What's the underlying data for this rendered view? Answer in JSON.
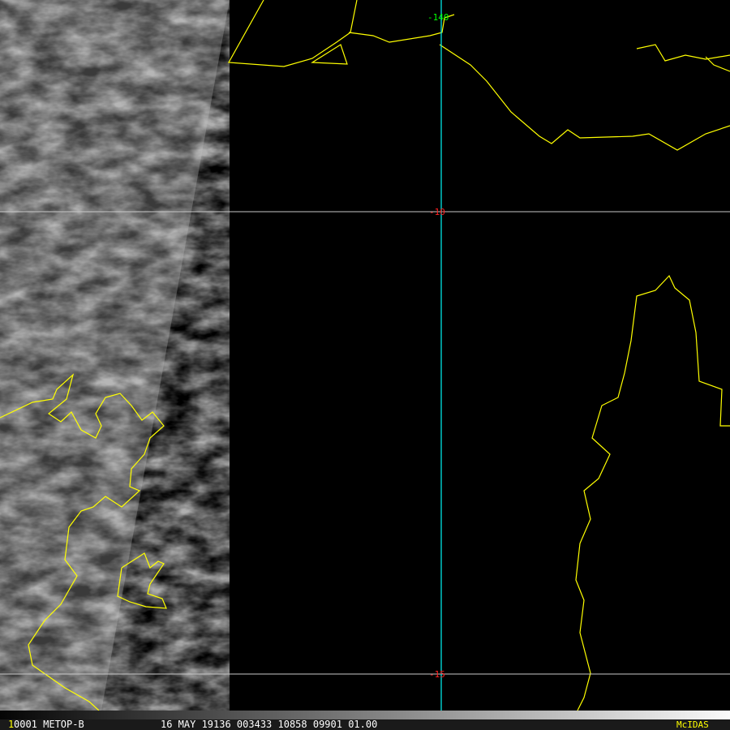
{
  "status_bar": {
    "frame_number": "1",
    "info_left": "0001 METOP-B",
    "info_mid": "16 MAY 19136 003433 10858 09901 01.00",
    "brand": "McIDAS"
  },
  "grid_labels": {
    "lon_top": "-140",
    "lat_mid": "-10",
    "lat_bottom": "-15"
  },
  "colors": {
    "coastline": "#ffff00",
    "lat_line": "#c8c8c8",
    "lon_line": "#00e5e5",
    "lat_label": "#ff2020",
    "lon_label": "#00ff00",
    "brand": "#ffff00"
  }
}
